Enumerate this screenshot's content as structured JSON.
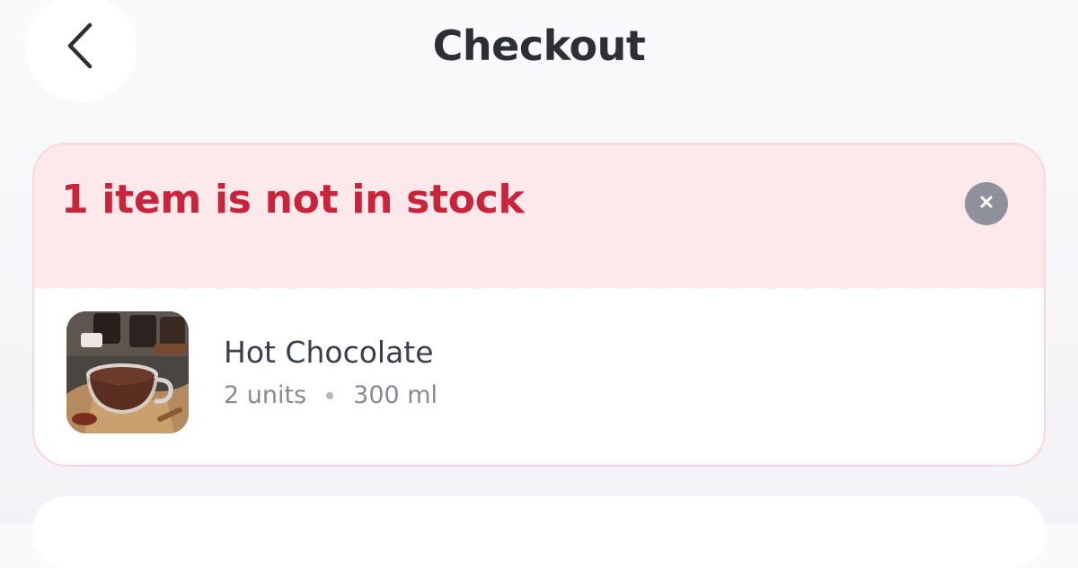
{
  "header": {
    "title": "Checkout",
    "back_icon": "chevron-left-icon"
  },
  "alert": {
    "message": "1 item is not in stock",
    "dismiss_icon": "close-icon",
    "background_color": "#fde8eb",
    "text_color": "#c8243c"
  },
  "product": {
    "name": "Hot Chocolate",
    "quantity": "2 units",
    "volume": "300 ml",
    "image": "hot-chocolate-photo"
  }
}
